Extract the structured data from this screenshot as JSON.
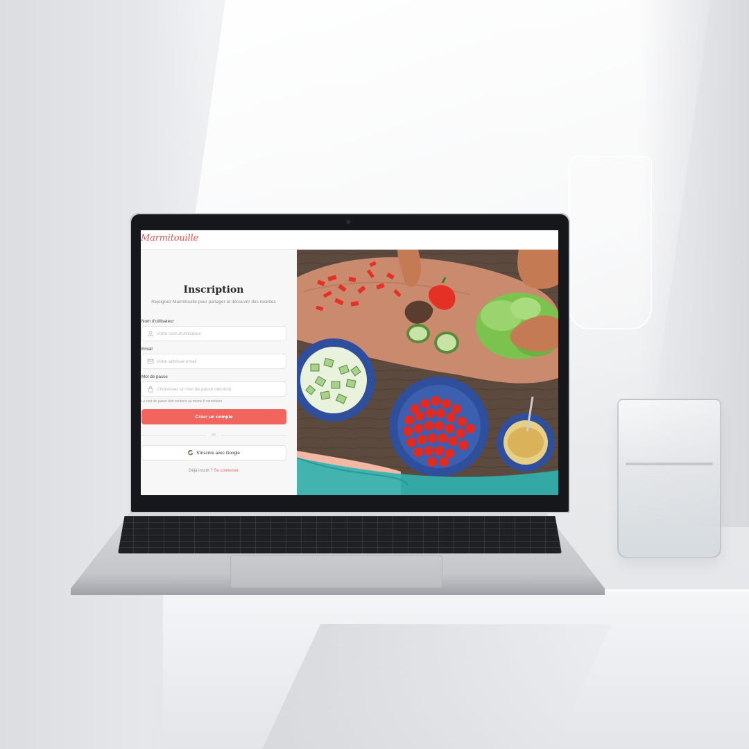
{
  "app": {
    "logo_text": "Marmitouille",
    "brand_color": "#f2645e"
  },
  "signup": {
    "title": "Inscription",
    "subtitle": "Rejoignez Marmitouille pour partager et découvrir des recettes",
    "username": {
      "label": "Nom d'utilisateur",
      "placeholder": "Votre nom d'utilisateur",
      "value": "",
      "icon": "user-icon"
    },
    "email": {
      "label": "Email",
      "placeholder": "Votre adresse email",
      "value": "",
      "icon": "mail-icon"
    },
    "password": {
      "label": "Mot de passe",
      "placeholder": "Choisissez un mot de passe sécurisé",
      "value": "",
      "icon": "lock-icon",
      "hint": "Le mot de passe doit contenir au moins 8 caractères"
    },
    "submit_label": "Créer un compte",
    "divider_text": "ou",
    "google_label": "S'inscrire avec Google",
    "google_icon": "google-icon",
    "already_text": "Déjà inscrit ?",
    "login_link": "Se connecter"
  },
  "hero_image": {
    "subject": "food-preparation-photo",
    "colors": {
      "board": "#c98a6e",
      "table": "#5b4a3d",
      "bowl": "#2f4e9c",
      "tomato": "#e02b22",
      "pepper": "#e53026",
      "lettuce": "#7cc24f",
      "cucumber": "#a9d18e",
      "cloth": "#2fb3b0",
      "sauce": "#d9b25a",
      "skin": "#c47a52"
    }
  }
}
